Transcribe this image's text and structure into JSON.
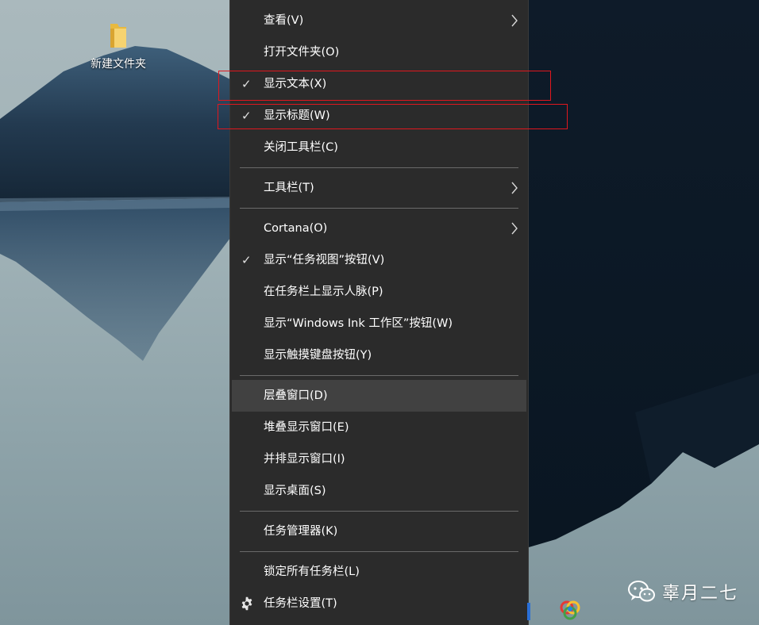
{
  "desktop": {
    "icon_label": "新建文件夹"
  },
  "menu": {
    "items": [
      {
        "label": "查看(V)",
        "checked": false,
        "submenu": true
      },
      {
        "label": "打开文件夹(O)",
        "checked": false,
        "submenu": false
      },
      {
        "label": "显示文本(X)",
        "checked": true,
        "submenu": false
      },
      {
        "label": "显示标题(W)",
        "checked": true,
        "submenu": false
      },
      {
        "label": "关闭工具栏(C)",
        "checked": false,
        "submenu": false
      },
      {
        "label": "工具栏(T)",
        "checked": false,
        "submenu": true
      },
      {
        "label": "Cortana(O)",
        "checked": false,
        "submenu": true
      },
      {
        "label": "显示“任务视图”按钮(V)",
        "checked": true,
        "submenu": false
      },
      {
        "label": "在任务栏上显示人脉(P)",
        "checked": false,
        "submenu": false
      },
      {
        "label": "显示“Windows Ink 工作区”按钮(W)",
        "checked": false,
        "submenu": false
      },
      {
        "label": "显示触摸键盘按钮(Y)",
        "checked": false,
        "submenu": false
      },
      {
        "label": "层叠窗口(D)",
        "checked": false,
        "submenu": false,
        "highlighted": true
      },
      {
        "label": "堆叠显示窗口(E)",
        "checked": false,
        "submenu": false
      },
      {
        "label": "并排显示窗口(I)",
        "checked": false,
        "submenu": false
      },
      {
        "label": "显示桌面(S)",
        "checked": false,
        "submenu": false
      },
      {
        "label": "任务管理器(K)",
        "checked": false,
        "submenu": false
      },
      {
        "label": "锁定所有任务栏(L)",
        "checked": false,
        "submenu": false
      },
      {
        "label": "任务栏设置(T)",
        "checked": false,
        "submenu": false,
        "icon": "gear-icon"
      }
    ],
    "check_glyph": "✓"
  },
  "watermark": {
    "text": "辜月二七",
    "icon": "wechat-icon"
  },
  "colors": {
    "menu_bg": "#2b2b2b",
    "menu_hover": "#414141",
    "separator": "#6a6a6a",
    "highlight_box": "#e0171e"
  }
}
